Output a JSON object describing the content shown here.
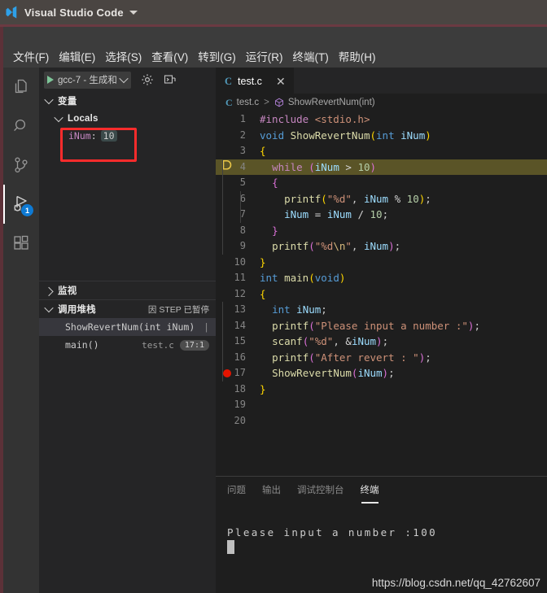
{
  "titlebar": {
    "app_title": "Visual Studio Code",
    "logo_icon": "vscode-logo",
    "caret_icon": "chevron-down-icon"
  },
  "menubar": {
    "items": [
      {
        "label": "文件(F)"
      },
      {
        "label": "编辑(E)"
      },
      {
        "label": "选择(S)"
      },
      {
        "label": "查看(V)"
      },
      {
        "label": "转到(G)"
      },
      {
        "label": "运行(R)"
      },
      {
        "label": "终端(T)"
      },
      {
        "label": "帮助(H)"
      }
    ]
  },
  "activitybar": {
    "items": [
      {
        "name": "explorer",
        "icon": "files-icon",
        "active": false
      },
      {
        "name": "search",
        "icon": "search-icon",
        "active": false
      },
      {
        "name": "source-control",
        "icon": "source-control-icon",
        "active": false
      },
      {
        "name": "run-and-debug",
        "icon": "run-debug-icon",
        "active": true,
        "badge": "1"
      },
      {
        "name": "extensions",
        "icon": "extensions-icon",
        "active": false
      }
    ]
  },
  "sidebar": {
    "toolbar": {
      "play_icon": "play-icon",
      "config_label": "gcc-7 - 生成和",
      "dropdown_icon": "chevron-down-icon",
      "gear_icon": "gear-icon",
      "debug_console_icon": "open-debug-console-icon"
    },
    "variables": {
      "title": "变量",
      "scopes": [
        {
          "name": "Locals",
          "rows": [
            {
              "name": "iNum",
              "separator": ":",
              "value": "10",
              "highlighted": true
            }
          ]
        }
      ]
    },
    "watch": {
      "title": "监视",
      "collapsed": true
    },
    "callstack": {
      "title": "调用堆栈",
      "status": "因 STEP 已暂停",
      "frames": [
        {
          "label": "ShowRevertNum(int iNum)",
          "file": "",
          "position": "",
          "selected": true
        },
        {
          "label": "main()",
          "file": "test.c",
          "position": "17:1",
          "selected": false
        }
      ]
    }
  },
  "editor": {
    "tabs": [
      {
        "icon": "c-file-icon",
        "label": "test.c",
        "close_icon": "close-icon",
        "active": true
      }
    ],
    "breadcrumb": {
      "file_icon": "c-file-icon",
      "file": "test.c",
      "separator": ">",
      "symbol_icon": "symbol-method-icon",
      "symbol": "ShowRevertNum(int)"
    },
    "lines": [
      {
        "n": "1",
        "bp": false,
        "cur": false,
        "hl": false,
        "guides": 0,
        "tokens": [
          {
            "t": "#include ",
            "c": "t-pre"
          },
          {
            "t": "<stdio.h>",
            "c": "t-inc"
          }
        ]
      },
      {
        "n": "2",
        "bp": false,
        "cur": false,
        "hl": false,
        "guides": 0,
        "tokens": [
          {
            "t": "void ",
            "c": "t-key"
          },
          {
            "t": "ShowRevertNum",
            "c": "t-fn"
          },
          {
            "t": "(",
            "c": "t-br1"
          },
          {
            "t": "int ",
            "c": "t-key"
          },
          {
            "t": "iNum",
            "c": "t-var"
          },
          {
            "t": ")",
            "c": "t-br1"
          }
        ]
      },
      {
        "n": "3",
        "bp": false,
        "cur": false,
        "hl": false,
        "guides": 0,
        "tokens": [
          {
            "t": "{",
            "c": "t-br1"
          }
        ]
      },
      {
        "n": "4",
        "bp": false,
        "cur": true,
        "hl": true,
        "guides": 1,
        "tokens": [
          {
            "t": "  ",
            "c": "t-pun"
          },
          {
            "t": "while ",
            "c": "t-ctl"
          },
          {
            "t": "(",
            "c": "t-br2"
          },
          {
            "t": "iNum ",
            "c": "t-var"
          },
          {
            "t": "> ",
            "c": "t-op"
          },
          {
            "t": "10",
            "c": "t-num"
          },
          {
            "t": ")",
            "c": "t-br2"
          }
        ]
      },
      {
        "n": "5",
        "bp": false,
        "cur": false,
        "hl": false,
        "guides": 1,
        "tokens": [
          {
            "t": "  ",
            "c": "t-pun"
          },
          {
            "t": "{",
            "c": "t-br2"
          }
        ]
      },
      {
        "n": "6",
        "bp": false,
        "cur": false,
        "hl": false,
        "guides": 2,
        "tokens": [
          {
            "t": "    ",
            "c": "t-pun"
          },
          {
            "t": "printf",
            "c": "t-fn"
          },
          {
            "t": "(",
            "c": "t-br1"
          },
          {
            "t": "\"%d\"",
            "c": "t-str"
          },
          {
            "t": ", ",
            "c": "t-pun"
          },
          {
            "t": "iNum ",
            "c": "t-var"
          },
          {
            "t": "% ",
            "c": "t-op"
          },
          {
            "t": "10",
            "c": "t-num"
          },
          {
            "t": ")",
            "c": "t-br1"
          },
          {
            "t": ";",
            "c": "t-pun"
          }
        ]
      },
      {
        "n": "7",
        "bp": false,
        "cur": false,
        "hl": false,
        "guides": 2,
        "tokens": [
          {
            "t": "    ",
            "c": "t-pun"
          },
          {
            "t": "iNum ",
            "c": "t-var"
          },
          {
            "t": "= ",
            "c": "t-op"
          },
          {
            "t": "iNum ",
            "c": "t-var"
          },
          {
            "t": "/ ",
            "c": "t-op"
          },
          {
            "t": "10",
            "c": "t-num"
          },
          {
            "t": ";",
            "c": "t-pun"
          }
        ]
      },
      {
        "n": "8",
        "bp": false,
        "cur": false,
        "hl": false,
        "guides": 1,
        "tokens": [
          {
            "t": "  ",
            "c": "t-pun"
          },
          {
            "t": "}",
            "c": "t-br2"
          }
        ]
      },
      {
        "n": "9",
        "bp": false,
        "cur": false,
        "hl": false,
        "guides": 1,
        "tokens": [
          {
            "t": "  ",
            "c": "t-pun"
          },
          {
            "t": "printf",
            "c": "t-fn"
          },
          {
            "t": "(",
            "c": "t-br2"
          },
          {
            "t": "\"%d",
            "c": "t-str"
          },
          {
            "t": "\\n",
            "c": "t-esc"
          },
          {
            "t": "\"",
            "c": "t-str"
          },
          {
            "t": ", ",
            "c": "t-pun"
          },
          {
            "t": "iNum",
            "c": "t-var"
          },
          {
            "t": ")",
            "c": "t-br2"
          },
          {
            "t": ";",
            "c": "t-pun"
          }
        ]
      },
      {
        "n": "10",
        "bp": false,
        "cur": false,
        "hl": false,
        "guides": 0,
        "tokens": [
          {
            "t": "}",
            "c": "t-br1"
          }
        ]
      },
      {
        "n": "11",
        "bp": false,
        "cur": false,
        "hl": false,
        "guides": 0,
        "tokens": [
          {
            "t": "int ",
            "c": "t-key"
          },
          {
            "t": "main",
            "c": "t-fn"
          },
          {
            "t": "(",
            "c": "t-br1"
          },
          {
            "t": "void",
            "c": "t-key"
          },
          {
            "t": ")",
            "c": "t-br1"
          }
        ]
      },
      {
        "n": "12",
        "bp": false,
        "cur": false,
        "hl": false,
        "guides": 0,
        "tokens": [
          {
            "t": "{",
            "c": "t-br1"
          }
        ]
      },
      {
        "n": "13",
        "bp": false,
        "cur": false,
        "hl": false,
        "guides": 1,
        "tokens": [
          {
            "t": "  ",
            "c": "t-pun"
          },
          {
            "t": "int ",
            "c": "t-key"
          },
          {
            "t": "iNum",
            "c": "t-var"
          },
          {
            "t": ";",
            "c": "t-pun"
          }
        ]
      },
      {
        "n": "14",
        "bp": false,
        "cur": false,
        "hl": false,
        "guides": 1,
        "tokens": [
          {
            "t": "  ",
            "c": "t-pun"
          },
          {
            "t": "printf",
            "c": "t-fn"
          },
          {
            "t": "(",
            "c": "t-br2"
          },
          {
            "t": "\"Please input a number :\"",
            "c": "t-str"
          },
          {
            "t": ")",
            "c": "t-br2"
          },
          {
            "t": ";",
            "c": "t-pun"
          }
        ]
      },
      {
        "n": "15",
        "bp": false,
        "cur": false,
        "hl": false,
        "guides": 1,
        "tokens": [
          {
            "t": "  ",
            "c": "t-pun"
          },
          {
            "t": "scanf",
            "c": "t-fn"
          },
          {
            "t": "(",
            "c": "t-br2"
          },
          {
            "t": "\"%d\"",
            "c": "t-str"
          },
          {
            "t": ", ",
            "c": "t-pun"
          },
          {
            "t": "&",
            "c": "t-op"
          },
          {
            "t": "iNum",
            "c": "t-var"
          },
          {
            "t": ")",
            "c": "t-br2"
          },
          {
            "t": ";",
            "c": "t-pun"
          }
        ]
      },
      {
        "n": "16",
        "bp": false,
        "cur": false,
        "hl": false,
        "guides": 1,
        "tokens": [
          {
            "t": "  ",
            "c": "t-pun"
          },
          {
            "t": "printf",
            "c": "t-fn"
          },
          {
            "t": "(",
            "c": "t-br2"
          },
          {
            "t": "\"After revert : \"",
            "c": "t-str"
          },
          {
            "t": ")",
            "c": "t-br2"
          },
          {
            "t": ";",
            "c": "t-pun"
          }
        ]
      },
      {
        "n": "17",
        "bp": true,
        "cur": false,
        "hl": false,
        "guides": 1,
        "tokens": [
          {
            "t": "  ",
            "c": "t-pun"
          },
          {
            "t": "ShowRevertNum",
            "c": "t-fn"
          },
          {
            "t": "(",
            "c": "t-br2"
          },
          {
            "t": "iNum",
            "c": "t-var"
          },
          {
            "t": ")",
            "c": "t-br2"
          },
          {
            "t": ";",
            "c": "t-pun"
          }
        ]
      },
      {
        "n": "18",
        "bp": false,
        "cur": false,
        "hl": false,
        "guides": 0,
        "tokens": [
          {
            "t": "}",
            "c": "t-br1"
          }
        ]
      },
      {
        "n": "19",
        "bp": false,
        "cur": false,
        "hl": false,
        "guides": 0,
        "tokens": []
      },
      {
        "n": "20",
        "bp": false,
        "cur": false,
        "hl": false,
        "guides": 0,
        "tokens": []
      }
    ]
  },
  "panel": {
    "tabs": [
      {
        "label": "问题",
        "active": false
      },
      {
        "label": "输出",
        "active": false
      },
      {
        "label": "调试控制台",
        "active": false
      },
      {
        "label": "终端",
        "active": true
      }
    ],
    "terminal": {
      "output": "Please input a number :100",
      "cursor": "block-cursor"
    }
  },
  "watermark": {
    "text": "https://blog.csdn.net/qq_42762607"
  },
  "colors": {
    "titlebar_bg": "#4a4542",
    "menubar_bg": "#3c3c3c",
    "activitybar_bg": "#333333",
    "sidebar_bg": "#252526",
    "editor_bg": "#1e1e1e",
    "accent_blue": "#0e7ad4",
    "highlight_line": "#5a5427",
    "breakpoint_red": "#e51400",
    "annotation_red": "#fb2c2c",
    "window_border": "#5c3138"
  }
}
